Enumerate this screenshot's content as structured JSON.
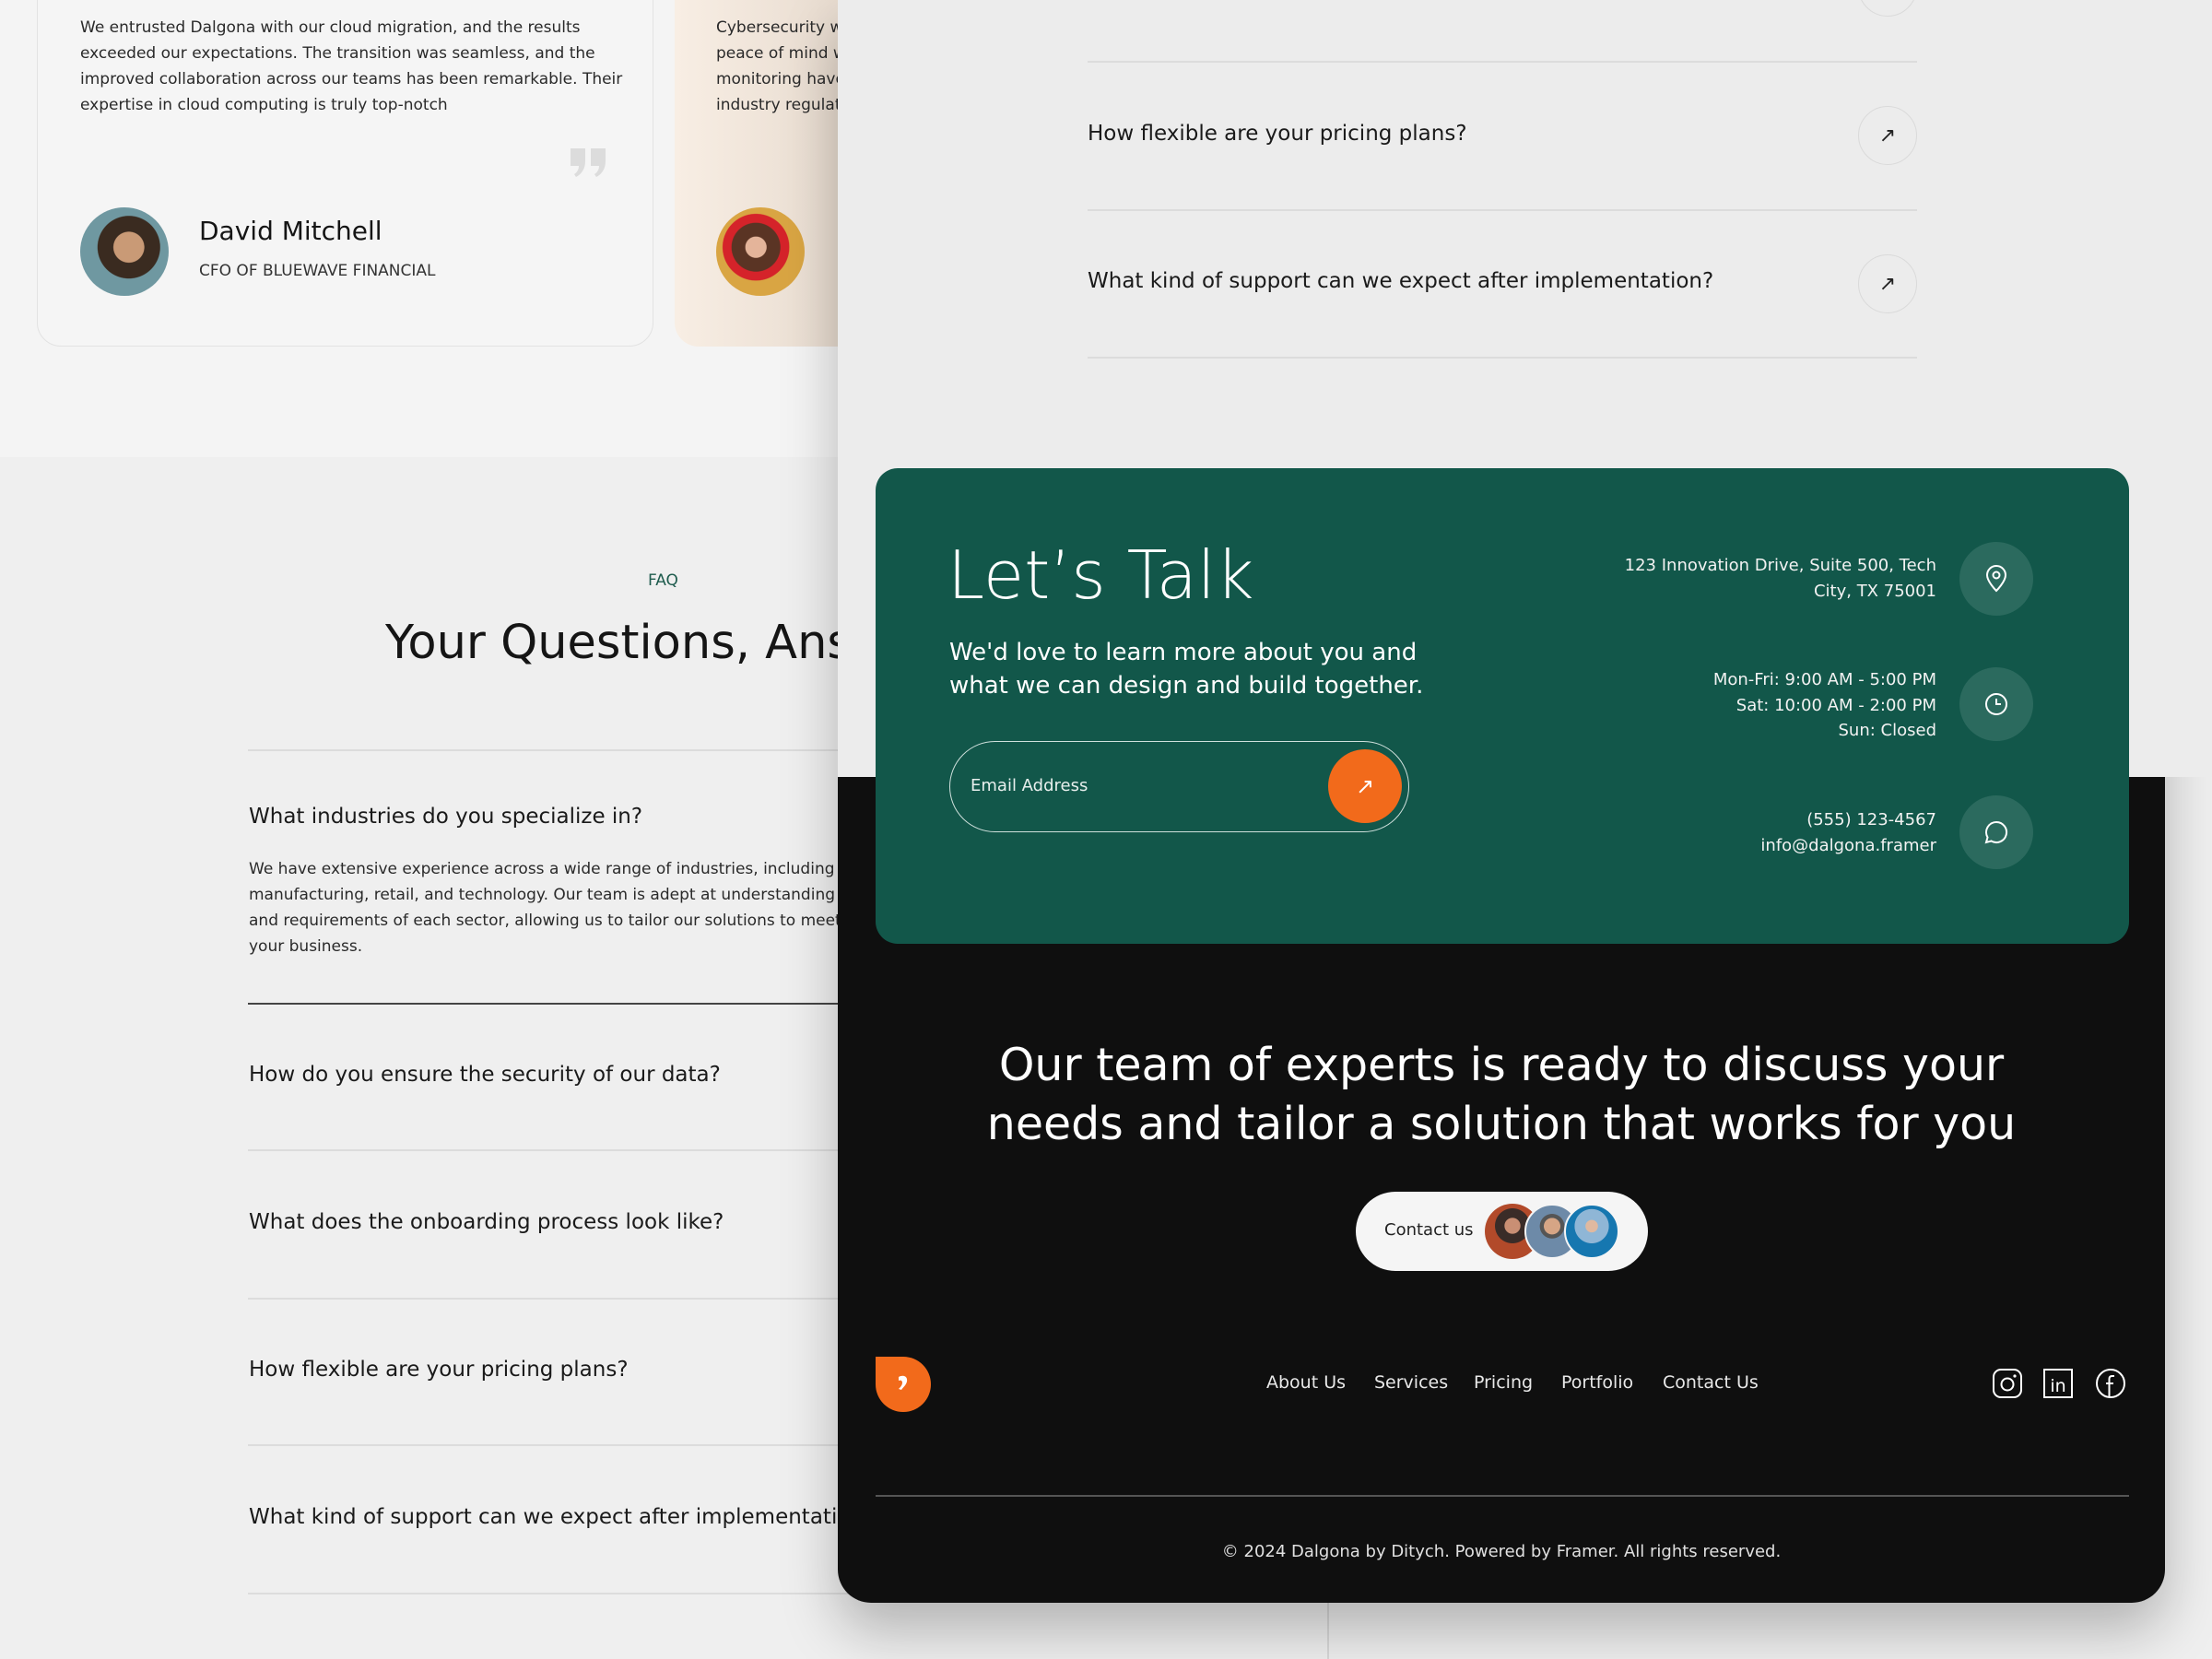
{
  "testimonials": [
    {
      "lines": [
        "We entrusted Dalgona with our cloud migration, and the results",
        "exceeded our expectations. The transition was seamless, and the",
        "improved collaboration across our teams has been remarkable. Their",
        "expertise in cloud computing is truly top-notch"
      ],
      "name": "David Mitchell",
      "role": "CFO OF BLUEWAVE FINANCIAL"
    },
    {
      "lines": [
        "Cybersecurity wa",
        "peace of mind w",
        "monitoring have",
        "industry regulati"
      ]
    }
  ],
  "faq": {
    "label": "FAQ",
    "title": "Your Questions, Answ",
    "items": [
      {
        "q": "What industries do you specialize in?",
        "answer": [
          "We have extensive experience across a wide range of industries, including finan",
          "manufacturing, retail, and technology. Our team is adept at understanding the u",
          "and requirements of each sector, allowing us to tailor our solutions to meet the s",
          "your business."
        ]
      },
      {
        "q": "How do you ensure the security of our data?"
      },
      {
        "q": "What does the onboarding process look like?"
      },
      {
        "q": "How flexible are your pricing plans?"
      },
      {
        "q": "What kind of support can we expect after implementation?"
      }
    ],
    "arrow": "↗"
  },
  "contact": {
    "title": "Let’s Talk",
    "subtitle": [
      "We'd love to learn more about you and",
      "what we can design and build together."
    ],
    "email_placeholder": "Email Address",
    "address": [
      "123 Innovation Drive, Suite 500,  Tech",
      "City, TX 75001"
    ],
    "hours": [
      "Mon-Fri: 9:00 AM - 5:00 PM",
      "Sat: 10:00 AM - 2:00 PM",
      "Sun: Closed"
    ],
    "phone": "(555) 123-4567",
    "email": "info@dalgona.framer"
  },
  "footer": {
    "headline": [
      "Our team of experts is ready to discuss your",
      "needs and tailor a solution that works for you"
    ],
    "contact_button": "Contact us",
    "nav": [
      "About Us",
      "Services",
      "Pricing",
      "Portfolio",
      "Contact Us"
    ],
    "copyright": "© 2024 Dalgona by Ditych. Powered by Framer. All rights reserved."
  },
  "colors": {
    "accent": "#f26a1b",
    "green": "#12574a",
    "dark": "#0f0f0f"
  }
}
